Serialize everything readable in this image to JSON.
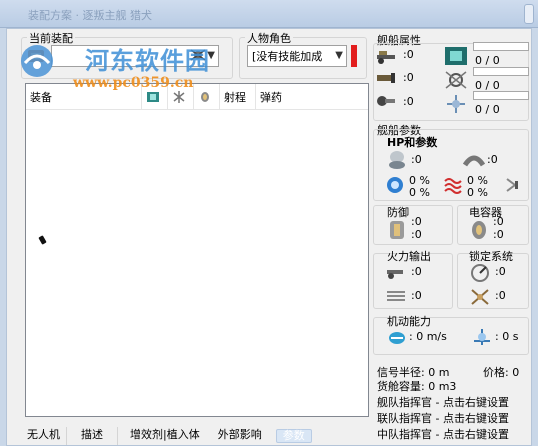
{
  "window": {
    "title": "装配方案 · 逐叛主舰 猎犬"
  },
  "watermark": {
    "line1": "河东软件园",
    "line2": "www.pc0359.cn"
  },
  "left": {
    "current_fit_label": "当前装配",
    "fit_combo_value": "",
    "role_label": "人物角色",
    "role_combo_value": "[没有技能加成",
    "columns": [
      "装备",
      "",
      "",
      "",
      "射程",
      "弹药"
    ]
  },
  "bottom_bar": [
    "无人机",
    "描述",
    "增效剂|植入体",
    "外部影响",
    "参数"
  ],
  "ship_attrs": {
    "label": "舰船属性",
    "rows": [
      ":0",
      ":0",
      ":0"
    ],
    "bars": [
      "0 / 0",
      "0 / 0",
      "0 / 0"
    ]
  },
  "ship_params": {
    "label": "舰船参数",
    "hp_label": "HP和参数",
    "hp_left": ":0",
    "hp_right": ":0",
    "resist": [
      "0 %",
      "0 %",
      "0 %",
      "0 %"
    ]
  },
  "defense": {
    "label": "防御",
    "v1": ":0",
    "v2": ":0"
  },
  "capacitor": {
    "label": "电容器",
    "v1": ":0",
    "v2": ":0"
  },
  "firepower": {
    "label": "火力输出",
    "v1": ":0",
    "v2": ":0"
  },
  "targeting": {
    "label": "锁定系统",
    "v1": ":0",
    "v2": ":0"
  },
  "mobility": {
    "label": "机动能力",
    "speed": ": 0 m/s",
    "align": ": 0 s"
  },
  "info": {
    "signature": "信号半径: 0 m",
    "price": "价格: 0",
    "cargo": "货舱容量: 0 m3",
    "fleet_cmd": "舰队指挥官 - 点击右键设置",
    "wing_cmd": "联队指挥官 - 点击右键设置",
    "squad_cmd": "中队指挥官 - 点击右键设置"
  },
  "colors": {
    "accent": "#e21d1d",
    "window_frame": "#c9d7e8"
  }
}
